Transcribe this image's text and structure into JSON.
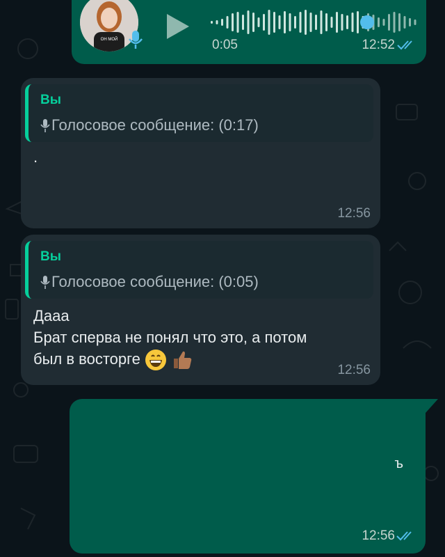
{
  "voice_message": {
    "duration": "0:05",
    "time": "12:52",
    "status": "read",
    "progress": 0.75,
    "icons": [
      "avatar",
      "mic-icon",
      "play-icon",
      "double-check-icon"
    ],
    "avatar_shirt_text": "ОН\nМОЙ",
    "colors": {
      "bubble": "#005c4b",
      "played": "#53bdeb",
      "unplayed": "#8fb8ae"
    }
  },
  "messages": [
    {
      "reply_author": "Вы",
      "reply_text": "Голосовое сообщение: (0:17)",
      "text_line1": ".",
      "text_line2": "",
      "text_line3": "",
      "time": "12:56"
    },
    {
      "reply_author": "Вы",
      "reply_text": "Голосовое сообщение: (0:05)",
      "text_line1": "Дааа",
      "text_line2": "Брат сперва не понял что это, а потом",
      "text_line3": "был в восторге",
      "emojis": [
        "grinning-face",
        "thumbs-up"
      ],
      "time": "12:56"
    }
  ],
  "outgoing_text": {
    "fragment": "ъ",
    "time": "12:56",
    "status": "read"
  },
  "colors": {
    "background": "#0b141a",
    "incoming_bubble": "#202c33",
    "accent": "#06cf9c",
    "read_ticks": "#53bdeb"
  }
}
